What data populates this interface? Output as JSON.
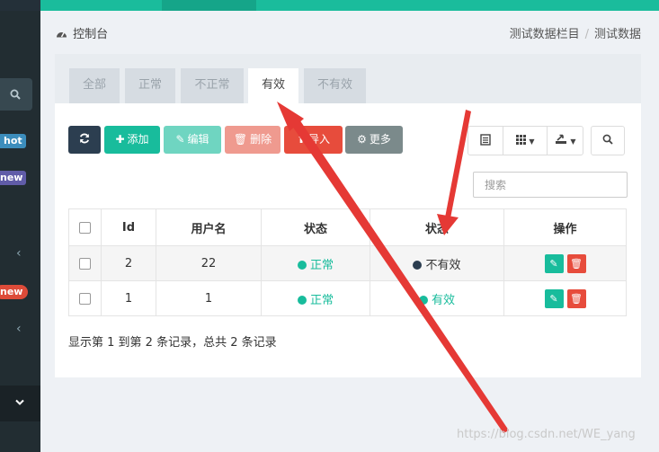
{
  "sidebar": {
    "search_icon": "search-icon",
    "badges": {
      "hot": "hot",
      "new1": "new",
      "new2": "new"
    }
  },
  "header": {
    "title_icon": "dashboard-icon",
    "title": "控制台",
    "breadcrumb": [
      "测试数据栏目",
      "测试数据"
    ]
  },
  "tabs": [
    {
      "label": "全部",
      "active": false
    },
    {
      "label": "正常",
      "active": false
    },
    {
      "label": "不正常",
      "active": false
    },
    {
      "label": "有效",
      "active": true
    },
    {
      "label": "不有效",
      "active": false
    }
  ],
  "toolbar": {
    "add": "添加",
    "edit": "编辑",
    "delete": "删除",
    "import": "导入",
    "more": "更多"
  },
  "search": {
    "placeholder": "搜索"
  },
  "table": {
    "headers": [
      "Id",
      "用户名",
      "状态",
      "状态",
      "操作"
    ],
    "rows": [
      {
        "id": "2",
        "username": "22",
        "status1": "正常",
        "status2": "不有效"
      },
      {
        "id": "1",
        "username": "1",
        "status1": "正常",
        "status2": "有效"
      }
    ]
  },
  "pagination": {
    "summary": "显示第 1 到第 2 条记录，总共 2 条记录"
  },
  "watermark": "https://blog.csdn.net/WE_yang",
  "colors": {
    "accent": "#18bc9c",
    "danger": "#e74c3c",
    "dark": "#2c3e50"
  }
}
